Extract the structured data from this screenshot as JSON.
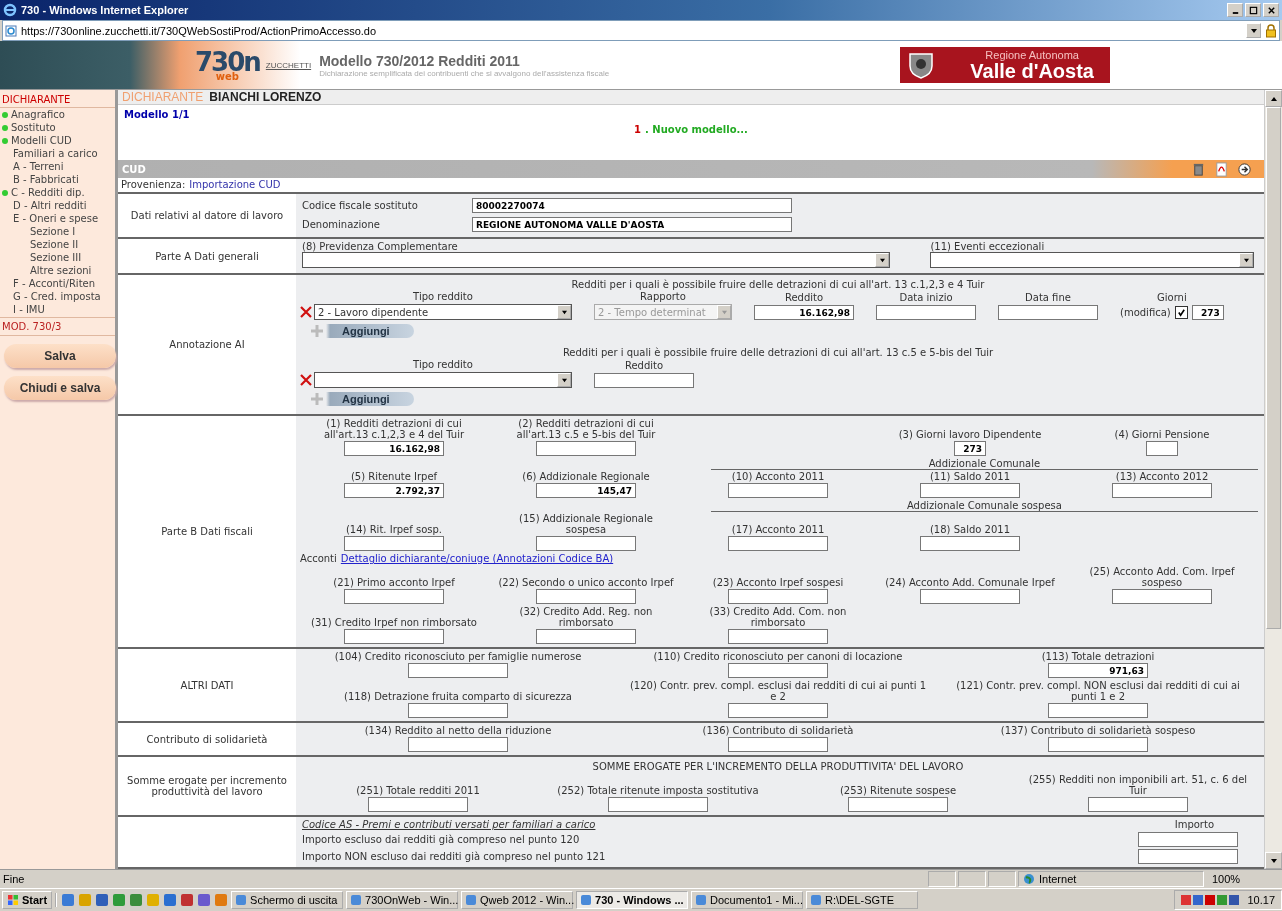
{
  "window": {
    "title": "730 - Windows Internet Explorer",
    "address": "https://730online.zucchetti.it/730QWebSostiProd/ActionPrimoAccesso.do"
  },
  "header": {
    "logo": "730n",
    "logo_sub": "web",
    "brand": "ZUCCHETTI",
    "title": "Modello 730/2012 Redditi 2011",
    "subtitle": "Dichiarazione semplificata dei contribuenti che si avvalgono dell'assistenza fiscale",
    "region_top": "Regione Autonoma",
    "region": "Valle d'Aosta"
  },
  "sidebar": {
    "heading": "DICHIARANTE",
    "items": [
      {
        "label": "Anagrafico",
        "done": true
      },
      {
        "label": "Sostituto",
        "done": true
      },
      {
        "label": "Modelli CUD",
        "done": true
      },
      {
        "label": "Familiari a carico",
        "done": false
      },
      {
        "label": "A - Terreni",
        "done": false
      },
      {
        "label": "B - Fabbricati",
        "done": false
      },
      {
        "label": "C - Redditi dip.",
        "done": true
      },
      {
        "label": "D - Altri redditi",
        "done": false
      },
      {
        "label": "E - Oneri e spese",
        "done": false,
        "children": [
          {
            "label": "Sezione I"
          },
          {
            "label": "Sezione II"
          },
          {
            "label": "Sezione III"
          },
          {
            "label": "Altre sezioni"
          }
        ]
      },
      {
        "label": "F - Acconti/Riten",
        "done": false
      },
      {
        "label": "G - Cred. imposta",
        "done": false
      },
      {
        "label": "I - IMU",
        "done": false
      }
    ],
    "footer": "MOD. 730/3",
    "buttons": [
      "Salva",
      "Chiudi e salva"
    ]
  },
  "breadcrumb": {
    "section": "DICHIARANTE",
    "name": "BIANCHI LORENZO"
  },
  "model": {
    "counter": "Modello 1/1",
    "number": "1",
    "action": ". Nuovo modello..."
  },
  "panel": {
    "title": "CUD",
    "source_label": "Provenienza:",
    "source": "Importazione CUD"
  },
  "sections": [
    {
      "label": "Dati relativi al datore di lavoro",
      "lines": [
        {
          "kind": "pairs",
          "pairs": [
            {
              "label": "Codice fiscale sostituto",
              "value": "80002270074"
            },
            {
              "label": "Denominazione",
              "value": "REGIONE AUTONOMA VALLE D'AOSTA"
            }
          ]
        }
      ]
    },
    {
      "label": "Parte A Dati generali",
      "lines": [
        {
          "kind": "selects",
          "selects": [
            {
              "label": "(8) Previdenza Complementare"
            },
            {
              "label": "(11) Eventi eccezionali"
            }
          ]
        }
      ]
    },
    {
      "label": "Annotazione AI",
      "lines": [
        {
          "kind": "caption",
          "text": "Redditi per i quali è possibile fruire delle detrazioni di cui all'art. 13 c.1,2,3 e 4 Tuir"
        },
        {
          "kind": "entry",
          "fields": [
            {
              "kind": "select",
              "label": "Tipo reddito",
              "value": "2 - Lavoro dipendente",
              "disabled": false
            },
            {
              "kind": "select",
              "label": "Rapporto",
              "value": "2 - Tempo determinat",
              "disabled": true
            },
            {
              "kind": "input",
              "label": "Reddito",
              "value": "16.162,98"
            },
            {
              "kind": "input",
              "label": "Data inizio"
            },
            {
              "kind": "input",
              "label": "Data fine"
            },
            {
              "kind": "days",
              "label": "Giorni",
              "note": "(modifica)",
              "checked": true,
              "value": "273"
            }
          ]
        },
        {
          "kind": "add",
          "label": "Aggiungi"
        },
        {
          "kind": "caption",
          "text": "Redditi per i quali è possibile fruire delle detrazioni di cui all'art. 13 c.5 e 5-bis del Tuir"
        },
        {
          "kind": "entry",
          "fields": [
            {
              "kind": "select",
              "label": "Tipo reddito",
              "disabled": false
            },
            {
              "kind": "input",
              "label": "Reddito"
            }
          ]
        },
        {
          "kind": "add",
          "label": "Aggiungi"
        }
      ]
    },
    {
      "label": "Parte B Dati fiscali",
      "lines": [
        {
          "kind": "cells",
          "cells": [
            {
              "kind": "field",
              "label": "(1) Redditi detrazioni di cui all'art.13 c.1,2,3 e 4 del Tuir",
              "value": "16.162,98"
            },
            {
              "kind": "field",
              "label": "(2) Redditi detrazioni di cui all'art.13 c.5 e 5-bis del Tuir"
            },
            {
              "kind": "blank"
            },
            {
              "kind": "field",
              "label": "(3) Giorni lavoro Dipendente",
              "value": "273"
            },
            {
              "kind": "field",
              "label": "(4) Giorni Pensione"
            }
          ]
        },
        {
          "kind": "subcaption",
          "text": "Addizionale Comunale"
        },
        {
          "kind": "cells",
          "cells": [
            {
              "kind": "field",
              "label": "(5) Ritenute Irpef",
              "value": "2.792,37"
            },
            {
              "kind": "field",
              "label": "(6) Addizionale Regionale",
              "value": "145,47"
            },
            {
              "kind": "field",
              "label": "(10) Acconto 2011"
            },
            {
              "kind": "field",
              "label": "(11) Saldo 2011"
            },
            {
              "kind": "field",
              "label": "(13) Acconto 2012"
            }
          ]
        },
        {
          "kind": "subcaption",
          "text": "Addizionale Comunale sospesa"
        },
        {
          "kind": "cells",
          "cells": [
            {
              "kind": "field",
              "label": "(14) Rit. Irpef sosp."
            },
            {
              "kind": "field",
              "label": "(15) Addizionale Regionale sospesa"
            },
            {
              "kind": "field",
              "label": "(17) Acconto 2011"
            },
            {
              "kind": "field",
              "label": "(18) Saldo 2011"
            },
            {
              "kind": "blank"
            }
          ]
        },
        {
          "kind": "link",
          "prefix": "Acconti",
          "text": "Dettaglio dichiarante/coniuge (Annotazioni Codice BA)"
        },
        {
          "kind": "cells",
          "cells": [
            {
              "kind": "field",
              "label": "(21) Primo acconto Irpef"
            },
            {
              "kind": "field",
              "label": "(22) Secondo o unico acconto Irpef"
            },
            {
              "kind": "field",
              "label": "(23) Acconto Irpef sospesi"
            },
            {
              "kind": "field",
              "label": "(24) Acconto Add. Comunale Irpef"
            },
            {
              "kind": "field",
              "label": "(25) Acconto Add. Com. Irpef sospeso"
            }
          ]
        },
        {
          "kind": "cells",
          "cells": [
            {
              "kind": "field",
              "label": "(31) Credito Irpef non rimborsato"
            },
            {
              "kind": "field",
              "label": "(32) Credito Add. Reg. non rimborsato"
            },
            {
              "kind": "field",
              "label": "(33) Credito Add. Com. non rimborsato"
            },
            {
              "kind": "blank"
            },
            {
              "kind": "blank"
            }
          ]
        }
      ]
    },
    {
      "label": "ALTRI DATI",
      "lines": [
        {
          "kind": "cells",
          "cells": [
            {
              "kind": "field",
              "label": "(104) Credito riconosciuto per famiglie numerose"
            },
            {
              "kind": "field",
              "label": "(110) Credito riconosciuto per canoni di locazione"
            },
            {
              "kind": "field",
              "label": "(113) Totale detrazioni",
              "value": "971,63"
            }
          ]
        },
        {
          "kind": "cells",
          "cells": [
            {
              "kind": "field",
              "label": "(118) Detrazione fruita comparto di sicurezza"
            },
            {
              "kind": "field",
              "label": "(120) Contr. prev. compl. esclusi dai redditi di cui ai punti 1 e 2"
            },
            {
              "kind": "field",
              "label": "(121) Contr. prev. compl. NON esclusi dai redditi di cui ai punti 1 e 2"
            }
          ]
        }
      ]
    },
    {
      "label": "Contributo di solidarietà",
      "lines": [
        {
          "kind": "cells",
          "cells": [
            {
              "kind": "field",
              "label": "(134) Reddito al netto della riduzione"
            },
            {
              "kind": "field",
              "label": "(136) Contributo di solidarietà"
            },
            {
              "kind": "field",
              "label": "(137) Contributo di solidarietà sospeso"
            }
          ]
        }
      ]
    },
    {
      "label": "Somme erogate per incremento produttività del lavoro",
      "lines": [
        {
          "kind": "caption",
          "text": "SOMME EROGATE PER L'INCREMENTO DELLA PRODUTTIVITA' DEL LAVORO"
        },
        {
          "kind": "cells",
          "cells": [
            {
              "kind": "field",
              "label": "(251) Totale redditi 2011"
            },
            {
              "kind": "field",
              "label": "(252) Totale ritenute imposta sostitutiva"
            },
            {
              "kind": "field",
              "label": "(253) Ritenute sospese"
            },
            {
              "kind": "field",
              "label": "(255) Redditi non imponibili art. 51, c. 6 del Tuir"
            }
          ]
        }
      ]
    },
    {
      "lines": [
        {
          "kind": "list",
          "title": "Codice AS - Premi e contributi versati per familiari a carico",
          "column": "Importo",
          "rows": [
            {
              "label": "Importo escluso dai redditi già compreso nel punto 120"
            },
            {
              "label": "Importo NON escluso dai redditi già compreso nel punto 121"
            }
          ]
        }
      ]
    }
  ],
  "status": {
    "text": "Fine",
    "zone": "Internet",
    "zoom": "100%"
  },
  "taskbar": {
    "start": "Start",
    "tasks": [
      {
        "label": "Schermo di uscita",
        "selected": false
      },
      {
        "label": "730OnWeb - Win...",
        "selected": false
      },
      {
        "label": "Qweb 2012 - Win...",
        "selected": false
      },
      {
        "label": "730 - Windows ...",
        "selected": true
      },
      {
        "label": "Documento1 - Mi...",
        "selected": false
      },
      {
        "label": "R:\\DEL-SGTE",
        "selected": false
      }
    ],
    "clock": "10.17"
  }
}
